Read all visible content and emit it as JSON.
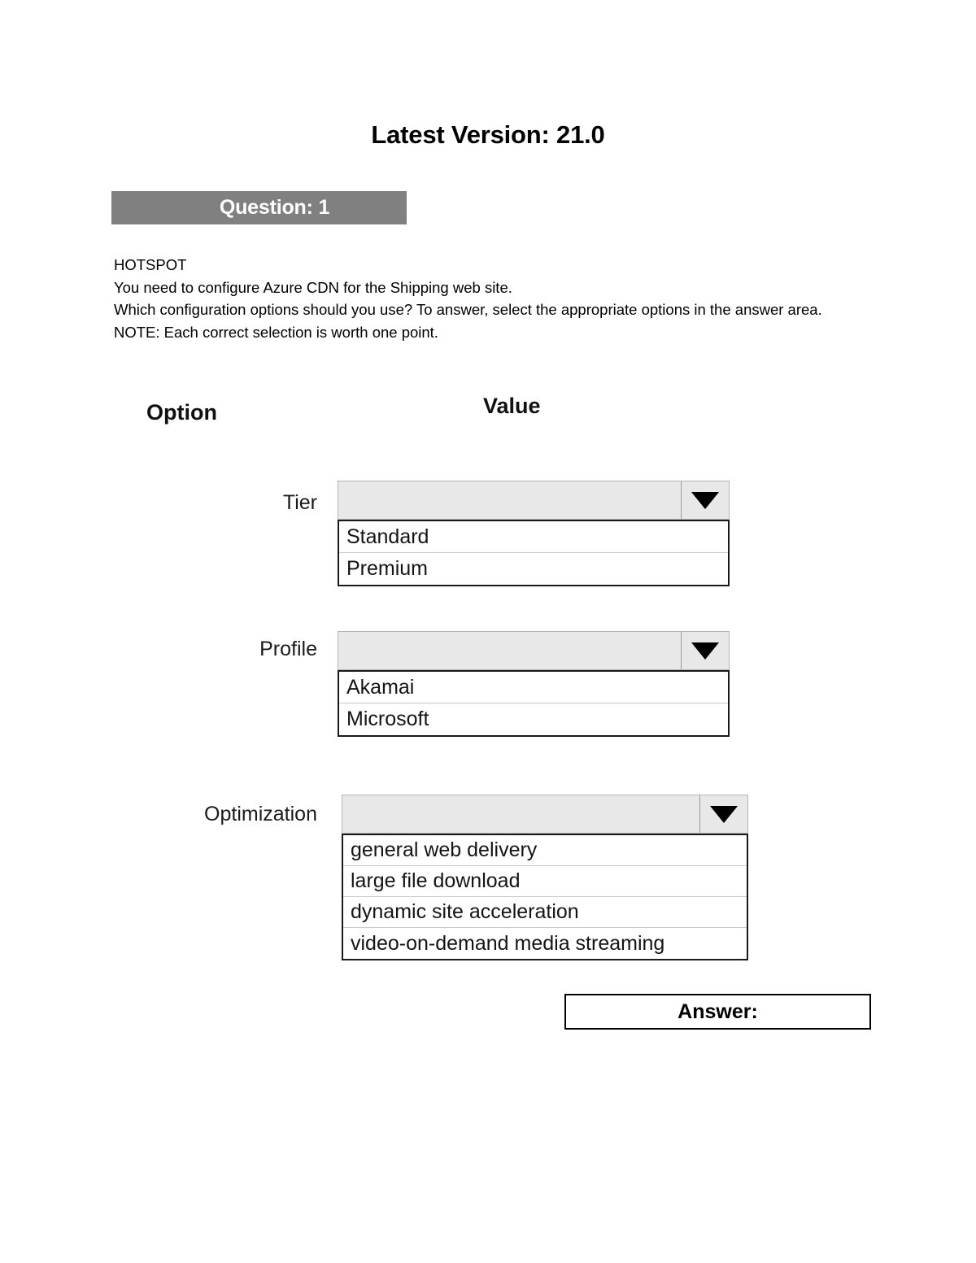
{
  "document": {
    "title": "Latest Version: 21.0"
  },
  "question": {
    "banner_label": "Question: 1",
    "lines": [
      "HOTSPOT",
      "You need to configure Azure CDN for the Shipping web site.",
      "Which configuration options should you use? To answer, select the appropriate options in the answer area.",
      "NOTE: Each correct selection is worth one point."
    ]
  },
  "hotspot": {
    "headers": {
      "option": "Option",
      "value": "Value"
    },
    "rows": [
      {
        "label": "Tier",
        "selected_value": "",
        "options": [
          "Standard",
          "Premium"
        ]
      },
      {
        "label": "Profile",
        "selected_value": "",
        "options": [
          "Akamai",
          "Microsoft"
        ]
      },
      {
        "label": "Optimization",
        "selected_value": "",
        "options": [
          "general web delivery",
          "large file download",
          "dynamic site acceleration",
          "video-on-demand media streaming"
        ]
      }
    ]
  },
  "answer": {
    "label": "Answer:"
  },
  "colors": {
    "banner_background": "#808080",
    "banner_text": "#ffffff",
    "dropdown_face": "#e8e8e8",
    "list_border": "#1a1a1a",
    "page_background": "#ffffff"
  },
  "icons": {
    "dropdown_arrow": "chevron-down-icon"
  }
}
